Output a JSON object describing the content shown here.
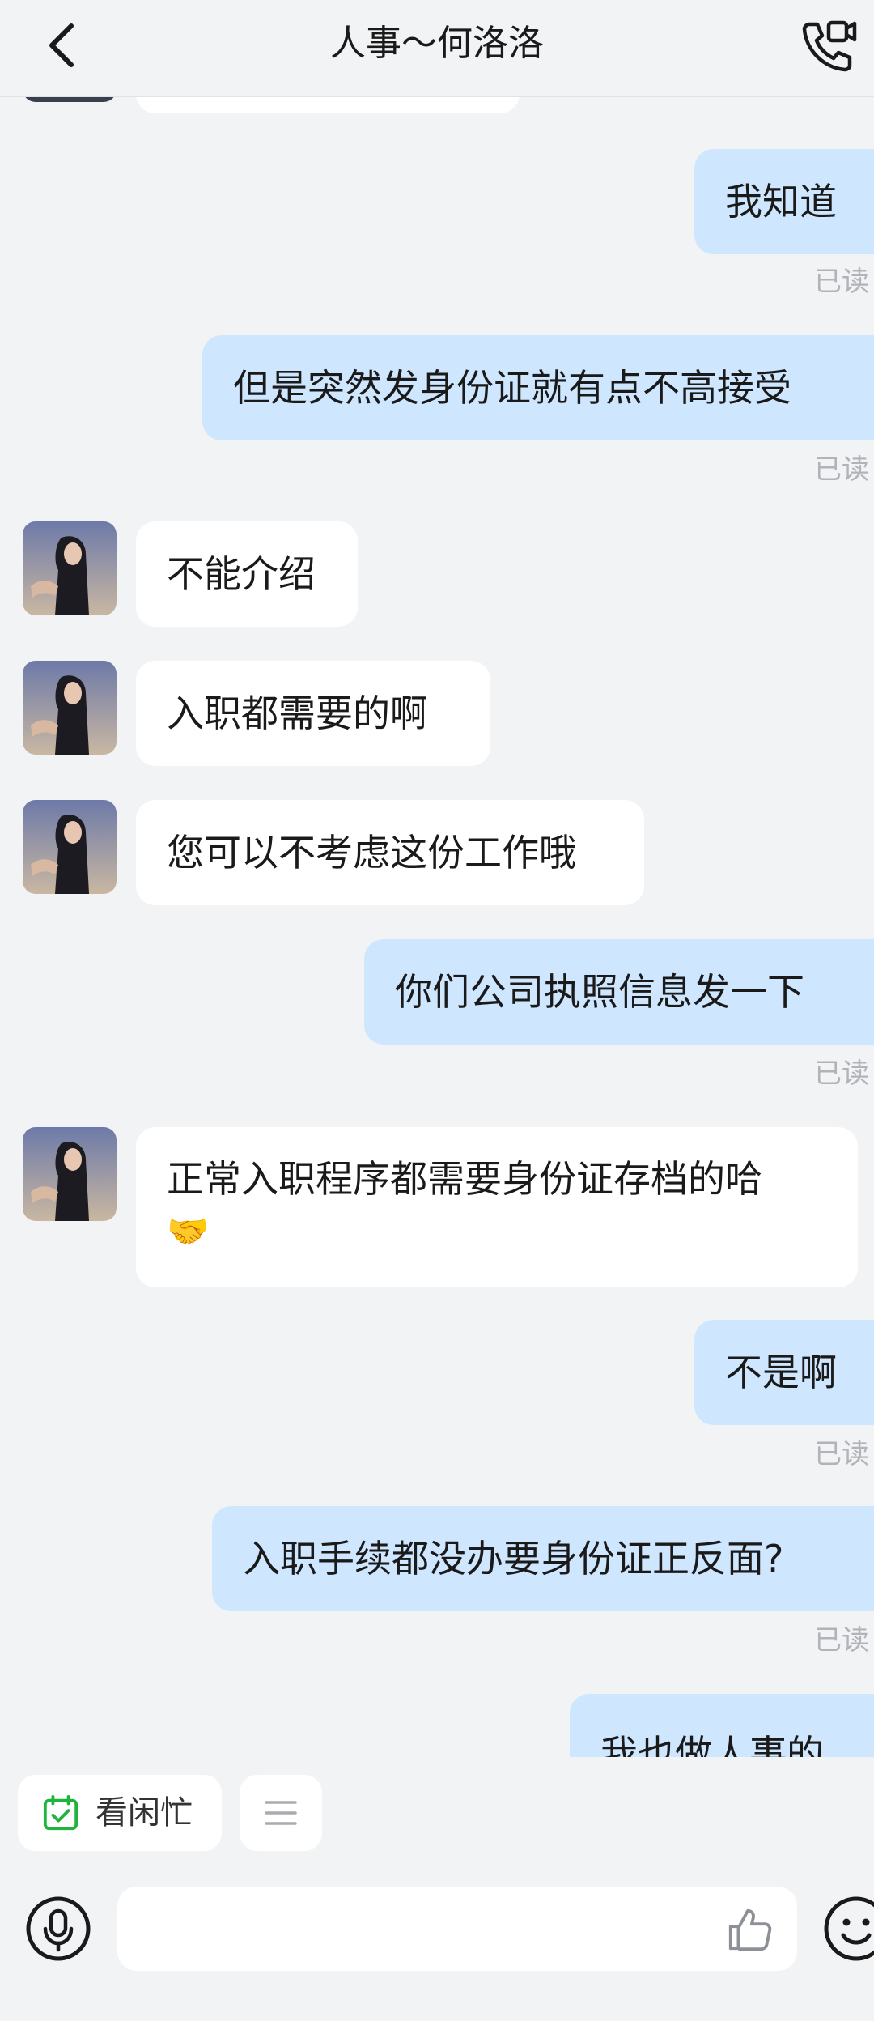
{
  "header": {
    "title": "人事～何洛洛"
  },
  "read_label": "已读",
  "messages": [
    {
      "dir": "out",
      "text": "我知道",
      "read": true
    },
    {
      "dir": "out",
      "text": "但是突然发身份证就有点不高接受",
      "read": true
    },
    {
      "dir": "in",
      "text": "不能介绍"
    },
    {
      "dir": "in",
      "text": "入职都需要的啊"
    },
    {
      "dir": "in",
      "text": "您可以不考虑这份工作哦"
    },
    {
      "dir": "out",
      "text": "你们公司执照信息发一下",
      "read": true
    },
    {
      "dir": "in",
      "text": "正常入职程序都需要身份证存档的哈",
      "emoji": "🤝"
    },
    {
      "dir": "out",
      "text": "不是啊",
      "read": true
    },
    {
      "dir": "out",
      "text": "入职手续都没办要身份证正反面?",
      "read": true
    },
    {
      "dir": "out",
      "text": "我也做人事的"
    }
  ],
  "quick_actions": {
    "availability_label": "看闲忙"
  },
  "icons": {
    "back": "chevron-left-icon",
    "call": "video-call-icon",
    "calendar": "calendar-check-icon",
    "menu": "menu-icon",
    "voice": "microphone-icon",
    "like": "thumbs-up-icon",
    "emoji": "smiley-icon"
  },
  "colors": {
    "outgoing_bubble": "#cfe6ff",
    "incoming_bubble": "#ffffff",
    "background": "#f2f3f5",
    "calendar_green": "#1fb53d"
  }
}
